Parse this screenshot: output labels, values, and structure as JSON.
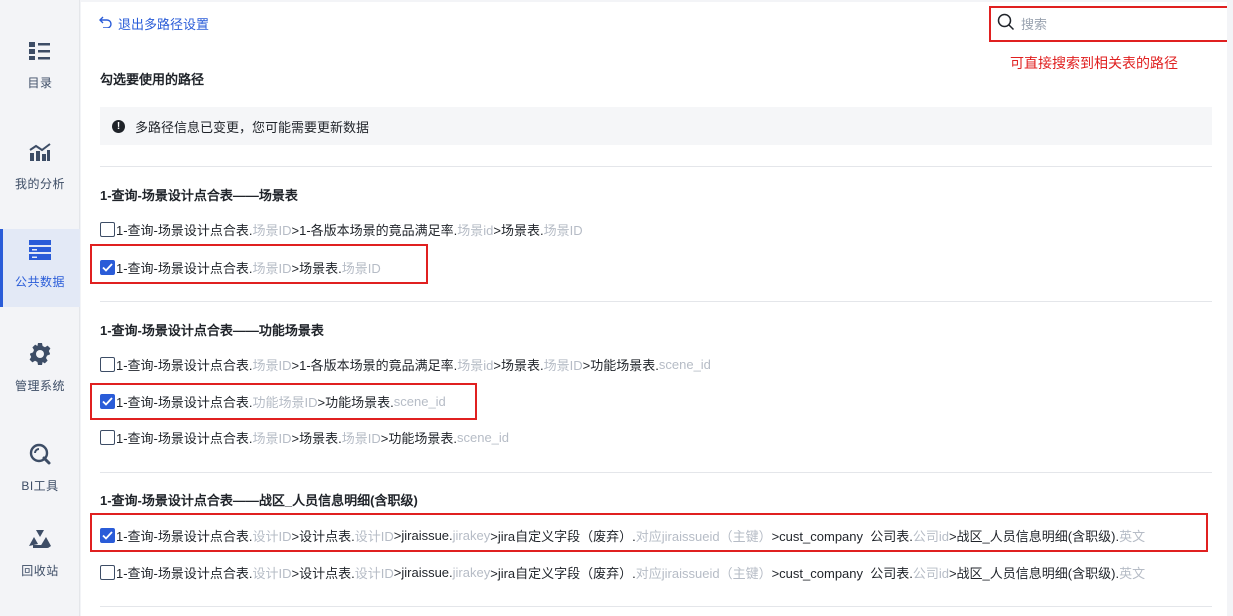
{
  "sidebar": {
    "items": [
      {
        "label": "目录",
        "icon": "catalog-icon"
      },
      {
        "label": "我的分析",
        "icon": "analysis-chart-icon"
      },
      {
        "label": "公共数据",
        "icon": "database-icon",
        "active": true
      },
      {
        "label": "管理系统",
        "icon": "gear-icon"
      },
      {
        "label": "BI工具",
        "icon": "tool-icon"
      },
      {
        "label": "回收站",
        "icon": "recycle-icon"
      }
    ]
  },
  "topbar": {
    "exit_label": "退出多路径设置",
    "search_placeholder": "搜索",
    "search_value": ""
  },
  "annotation": {
    "search_hint": "可直接搜索到相关表的路径"
  },
  "content": {
    "heading": "勾选要使用的路径",
    "notice": "多路径信息已变更，您可能需要更新数据",
    "groups": [
      {
        "title": "1-查询-场景设计点合表——场景表",
        "paths": [
          {
            "checked": false,
            "parts": [
              {
                "t": "1-查询-场景设计点合表."
              },
              {
                "t": "场景ID",
                "f": true
              },
              {
                "t": ">1-各版本场景的竟品满足率."
              },
              {
                "t": "场景id",
                "f": true
              },
              {
                "t": ">场景表."
              },
              {
                "t": "场景ID",
                "f": true
              }
            ]
          },
          {
            "checked": true,
            "parts": [
              {
                "t": "1-查询-场景设计点合表."
              },
              {
                "t": "场景ID",
                "f": true
              },
              {
                "t": ">场景表."
              },
              {
                "t": "场景ID",
                "f": true
              }
            ]
          }
        ]
      },
      {
        "title": "1-查询-场景设计点合表——功能场景表",
        "paths": [
          {
            "checked": false,
            "parts": [
              {
                "t": "1-查询-场景设计点合表."
              },
              {
                "t": "场景ID",
                "f": true
              },
              {
                "t": ">1-各版本场景的竟品满足率."
              },
              {
                "t": "场景id",
                "f": true
              },
              {
                "t": ">场景表."
              },
              {
                "t": "场景ID",
                "f": true
              },
              {
                "t": ">功能场景表."
              },
              {
                "t": "scene_id",
                "f": true
              }
            ]
          },
          {
            "checked": true,
            "parts": [
              {
                "t": "1-查询-场景设计点合表."
              },
              {
                "t": "功能场景ID",
                "f": true
              },
              {
                "t": ">功能场景表."
              },
              {
                "t": "scene_id",
                "f": true
              }
            ]
          },
          {
            "checked": false,
            "parts": [
              {
                "t": "1-查询-场景设计点合表."
              },
              {
                "t": "场景ID",
                "f": true
              },
              {
                "t": ">场景表."
              },
              {
                "t": "场景ID",
                "f": true
              },
              {
                "t": ">功能场景表."
              },
              {
                "t": "scene_id",
                "f": true
              }
            ]
          }
        ]
      },
      {
        "title": "1-查询-场景设计点合表——战区_人员信息明细(含职级)",
        "paths": [
          {
            "checked": true,
            "parts": [
              {
                "t": "1-查询-场景设计点合表."
              },
              {
                "t": "设计ID",
                "f": true
              },
              {
                "t": ">设计点表."
              },
              {
                "t": "设计ID",
                "f": true
              },
              {
                "t": ">jiraissue."
              },
              {
                "t": "jirakey",
                "f": true
              },
              {
                "t": ">jira自定义字段（废弃）."
              },
              {
                "t": "对应jiraissueid（主键）",
                "f": true
              },
              {
                "t": ">cust_company  公司表."
              },
              {
                "t": "公司id",
                "f": true
              },
              {
                "t": ">战区_人员信息明细(含职级)."
              },
              {
                "t": "英文",
                "f": true
              }
            ]
          },
          {
            "checked": false,
            "parts": [
              {
                "t": "1-查询-场景设计点合表."
              },
              {
                "t": "设计ID",
                "f": true
              },
              {
                "t": ">设计点表."
              },
              {
                "t": "设计ID",
                "f": true
              },
              {
                "t": ">jiraissue."
              },
              {
                "t": "jirakey",
                "f": true
              },
              {
                "t": ">jira自定义字段（废弃）."
              },
              {
                "t": "对应jiraissueid（主键）",
                "f": true
              },
              {
                "t": ">cust_company  公司表."
              },
              {
                "t": "公司id",
                "f": true
              },
              {
                "t": ">战区_人员信息明细(含职级)."
              },
              {
                "t": "英文",
                "f": true
              }
            ]
          }
        ]
      }
    ]
  },
  "colors": {
    "accent": "#2a5cd8",
    "annotation_red": "#e02020",
    "field_gray": "#b6bcc6"
  }
}
